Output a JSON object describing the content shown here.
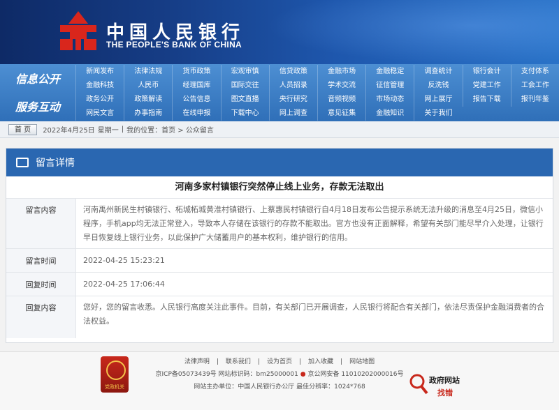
{
  "header": {
    "logo_cn": "中国人民银行",
    "logo_en": "THE PEOPLE'S BANK OF CHINA"
  },
  "nav": {
    "row1_label": "信息公开",
    "row2_label": "服务互动",
    "row1a": [
      "新闻发布",
      "法律法规",
      "货币政策",
      "宏观审慎",
      "信贷政策",
      "金融市场",
      "金融稳定",
      "调查统计",
      "银行会计",
      "支付体系"
    ],
    "row1b": [
      "金融科技",
      "人民币",
      "经理国库",
      "国际交往",
      "人员招录",
      "学术交流",
      "征信管理",
      "反洗钱",
      "党建工作",
      "工会工作"
    ],
    "row2a": [
      "政务公开",
      "政策解读",
      "公告信息",
      "图文直播",
      "央行研究",
      "音频视频",
      "市场动态",
      "网上展厅",
      "报告下载",
      "报刊年鉴"
    ],
    "row2b": [
      "网民文言",
      "办事指南",
      "在线申报",
      "下载中心",
      "网上调查",
      "意见征集",
      "金融知识",
      "关于我们"
    ]
  },
  "breadcrumb": {
    "home": "首 页",
    "date": "2022年4月25日",
    "weekday": "星期一",
    "sep": "|",
    "location": "我的位置：首页 > 公众留言"
  },
  "panel": {
    "heading": "留言详情",
    "title": "河南多家村镇银行突然停止线上业务，存款无法取出",
    "rows": [
      {
        "label": "留言内容",
        "value": "河南禹州新民生村镇银行、柘城柘城黄淮村镇银行、上蔡惠民村镇银行自4月18日发布公告提示系统无法升级的消息至4月25日，微信小程序，手机app均无法正常登入，导致本人存储在该银行的存款不能取出。官方也没有正面解释，希望有关部门能尽早介入处理，让银行早日恢复线上银行业务，以此保护广大储蓄用户的基本权利，维护银行的信用。"
      },
      {
        "label": "留言时间",
        "value": "2022-04-25 15:23:21"
      },
      {
        "label": "回复时间",
        "value": "2022-04-25 17:06:44"
      },
      {
        "label": "回复内容",
        "value": "您好，您的留言收悉。人民银行高度关注此事件。目前，有关部门已开展调查，人民银行将配合有关部门，依法尽责保护金融消费者的合法权益。"
      }
    ]
  },
  "footer": {
    "links": [
      "法律声明",
      "|",
      "联系我们",
      "|",
      "设为首页",
      "|",
      "加入收藏",
      "|",
      "网站地图"
    ],
    "icp": "京ICP备05073439号  网站标识码：bm25000001",
    "police": "京公网安备 11010202000016号",
    "host": "网站主办单位：中国人民银行办公厅   最佳分辨率：1024*768",
    "badge_text": "党政机关",
    "gov_title": "政府网站",
    "gov_action": "找错"
  },
  "colors": {
    "header": "#163d86",
    "nav": "#3d7fc6",
    "panel_head": "#2a67b1",
    "brand_red": "#c8281c"
  }
}
